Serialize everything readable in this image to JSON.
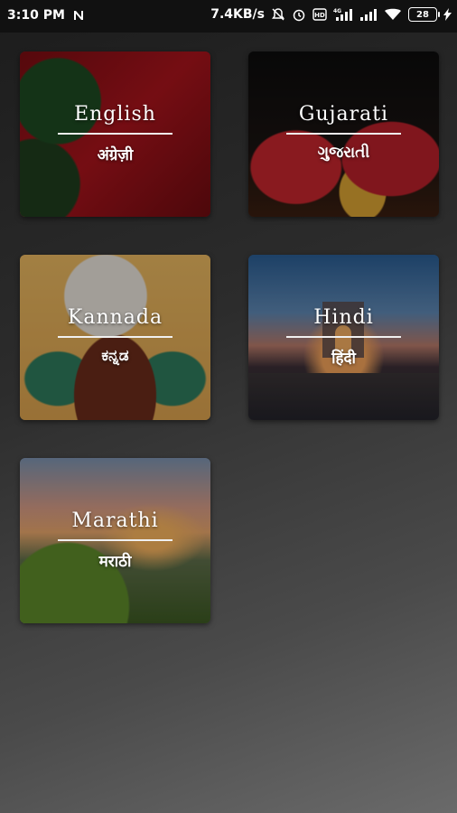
{
  "status_bar": {
    "time": "3:10 PM",
    "network_speed": "7.4KB/s",
    "battery": "28",
    "icons": [
      "notification-n-icon",
      "mute-bell-icon",
      "alarm-icon",
      "volte-icon",
      "signal-4g-icon",
      "signal-icon",
      "wifi-icon",
      "battery-icon",
      "charging-bolt-icon"
    ]
  },
  "languages": [
    {
      "name": "English",
      "native": "अंग्रेज़ी"
    },
    {
      "name": "Gujarati",
      "native": "ગુજરાતી"
    },
    {
      "name": "Kannada",
      "native": "ಕನ್ನಡ"
    },
    {
      "name": "Hindi",
      "native": "हिंदी"
    },
    {
      "name": "Marathi",
      "native": "मराठी"
    }
  ]
}
